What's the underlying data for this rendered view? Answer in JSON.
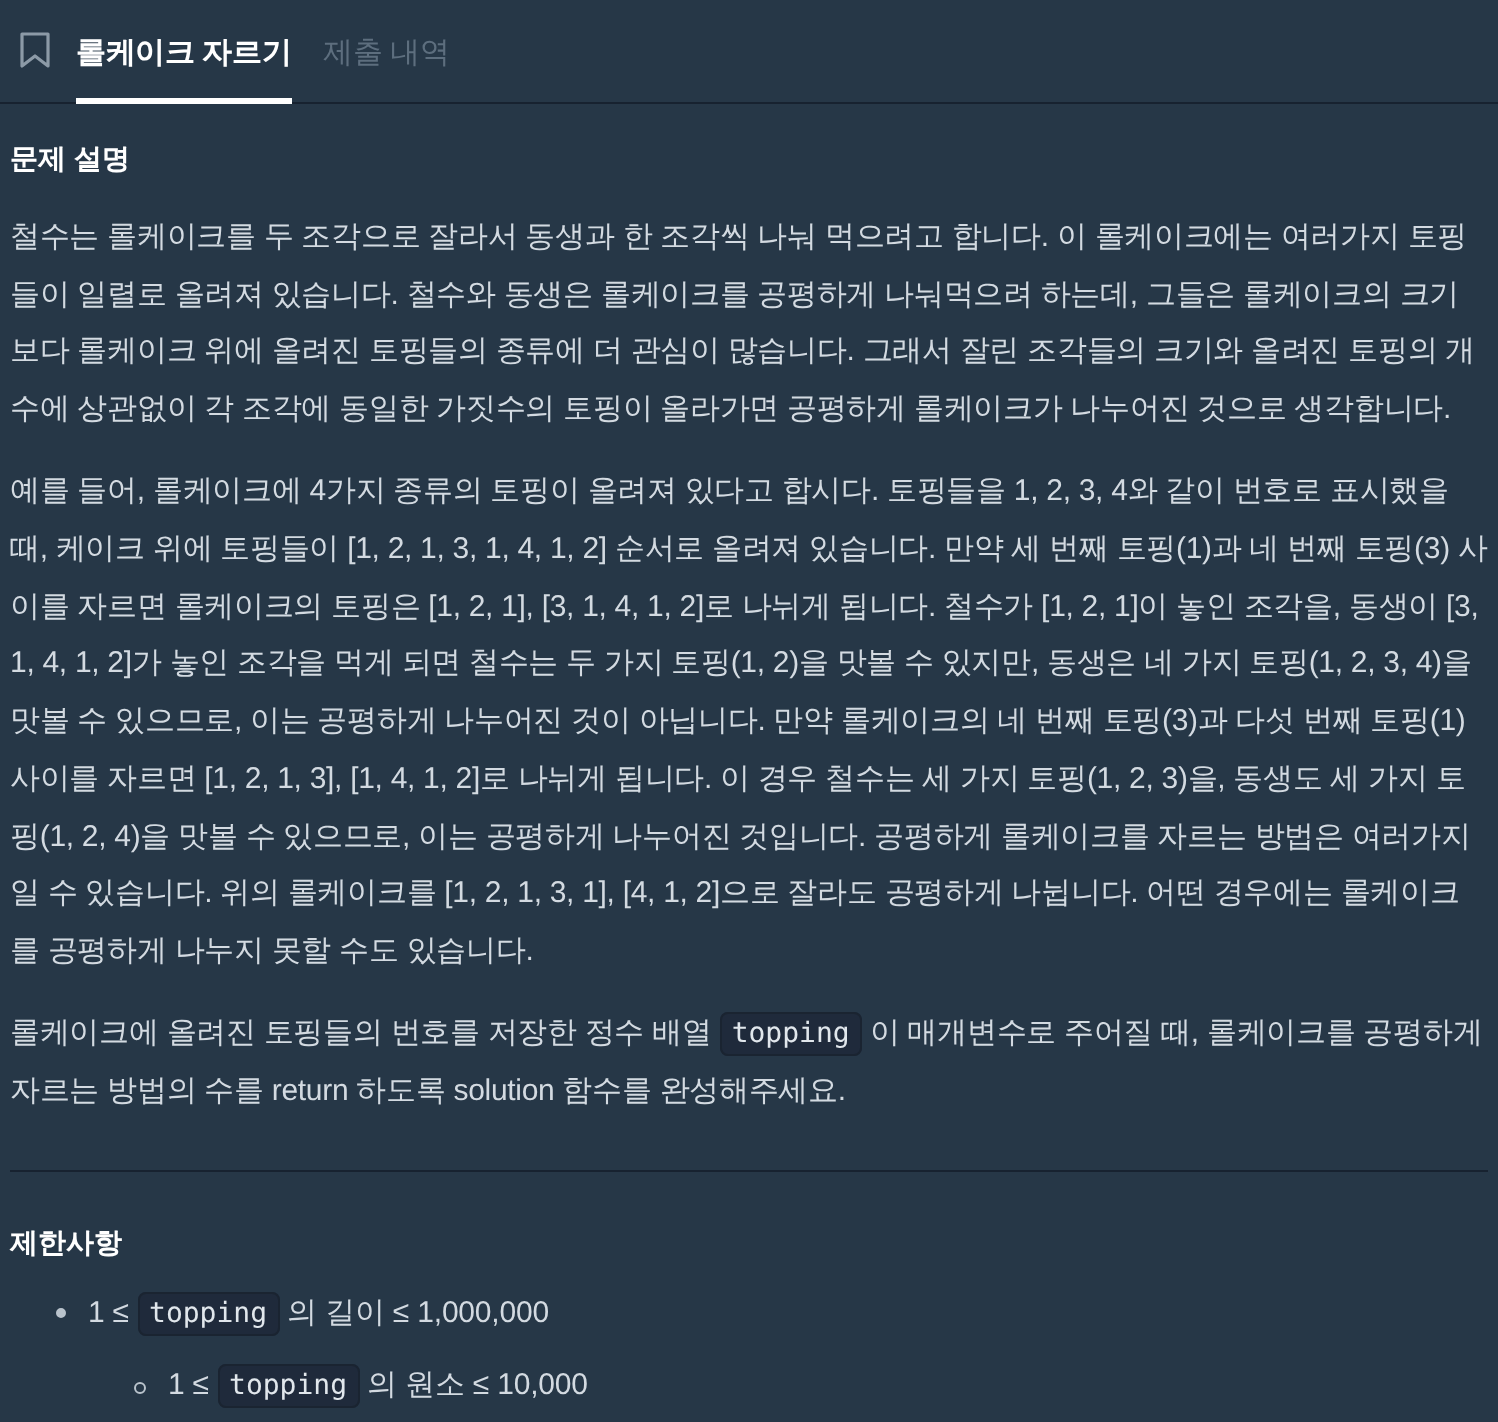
{
  "tabs": [
    {
      "label": "롤케이크 자르기",
      "selected": true
    },
    {
      "label": "제출 내역",
      "selected": false
    }
  ],
  "description": {
    "heading": "문제 설명",
    "paragraphs": [
      {
        "segments": [
          {
            "kind": "text",
            "text": "철수는 롤케이크를 두 조각으로 잘라서 동생과 한 조각씩 나눠 먹으려고 합니다. 이 롤케이크에는 여러가지 토핑들이 일렬로 올려져 있습니다. 철수와 동생은 롤케이크를 공평하게 나눠먹으려 하는데, 그들은 롤케이크의 크기보다 롤케이크 위에 올려진 토핑들의 종류에 더 관심이 많습니다. 그래서 잘린 조각들의 크기와 올려진 토핑의 개수에 상관없이 각 조각에 동일한 가짓수의 토핑이 올라가면 공평하게 롤케이크가 나누어진 것으로 생각합니다."
          }
        ]
      },
      {
        "segments": [
          {
            "kind": "text",
            "text": "예를 들어, 롤케이크에 4가지 종류의 토핑이 올려져 있다고 합시다. 토핑들을 1, 2, 3, 4와 같이 번호로 표시했을 때, 케이크 위에 토핑들이 [1, 2, 1, 3, 1, 4, 1, 2] 순서로 올려져 있습니다. 만약 세 번째 토핑(1)과 네 번째 토핑(3) 사이를 자르면 롤케이크의 토핑은 [1, 2, 1], [3, 1, 4, 1, 2]로 나뉘게 됩니다. 철수가 [1, 2, 1]이 놓인 조각을, 동생이 [3, 1, 4, 1, 2]가 놓인 조각을 먹게 되면 철수는 두 가지 토핑(1, 2)을 맛볼 수 있지만, 동생은 네 가지 토핑(1, 2, 3, 4)을 맛볼 수 있으므로, 이는 공평하게 나누어진 것이 아닙니다. 만약 롤케이크의 네 번째 토핑(3)과 다섯 번째 토핑(1) 사이를 자르면 [1, 2, 1, 3], [1, 4, 1, 2]로 나뉘게 됩니다. 이 경우 철수는 세 가지 토핑(1, 2, 3)을, 동생도 세 가지 토핑(1, 2, 4)을 맛볼 수 있으므로, 이는 공평하게 나누어진 것입니다. 공평하게 롤케이크를 자르는 방법은 여러가지 일 수 있습니다. 위의 롤케이크를 [1, 2, 1, 3, 1], [4, 1, 2]으로 잘라도 공평하게 나뉩니다. 어떤 경우에는 롤케이크를 공평하게 나누지 못할 수도 있습니다."
          }
        ]
      },
      {
        "segments": [
          {
            "kind": "text",
            "text": "롤케이크에 올려진 토핑들의 번호를 저장한 정수 배열 "
          },
          {
            "kind": "code",
            "text": "topping"
          },
          {
            "kind": "text",
            "text": " 이 매개변수로 주어질 때, 롤케이크를 공평하게 자르는 방법의 수를 return 하도록 solution 함수를 완성해주세요."
          }
        ]
      }
    ]
  },
  "constraints": {
    "heading": "제한사항",
    "items": [
      {
        "segments": [
          {
            "kind": "text",
            "text": "1 ≤ "
          },
          {
            "kind": "code",
            "text": "topping"
          },
          {
            "kind": "text",
            "text": " 의 길이 ≤ 1,000,000"
          }
        ],
        "children": [
          {
            "segments": [
              {
                "kind": "text",
                "text": "1 ≤ "
              },
              {
                "kind": "code",
                "text": "topping"
              },
              {
                "kind": "text",
                "text": " 의 원소 ≤ 10,000"
              }
            ]
          }
        ]
      }
    ]
  }
}
